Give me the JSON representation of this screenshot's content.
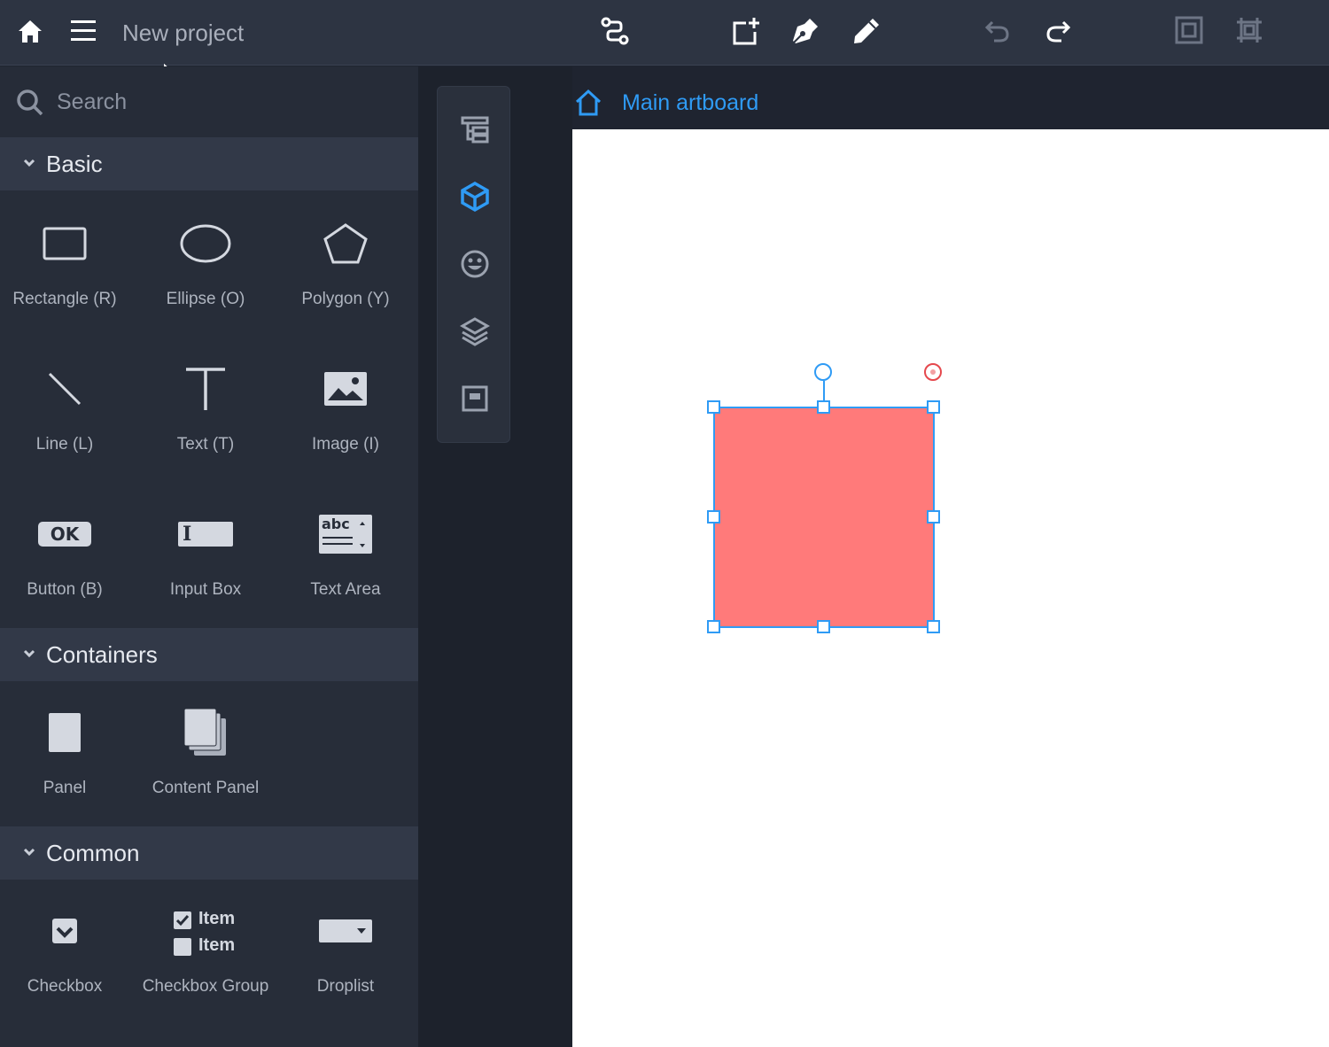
{
  "topbar": {
    "project_title": "New project",
    "icons": [
      "home-icon",
      "menu-icon",
      "connector-icon",
      "new-page-icon",
      "pen-icon",
      "pencil-icon",
      "undo-icon",
      "redo-icon",
      "frame-icon",
      "group-frame-icon"
    ]
  },
  "leftpanel": {
    "search": {
      "placeholder": "Search",
      "value": ""
    },
    "sections": {
      "basic": {
        "title": "Basic",
        "items": [
          {
            "label": "Rectangle (R)",
            "icon": "rectangle-icon"
          },
          {
            "label": "Ellipse (O)",
            "icon": "ellipse-icon"
          },
          {
            "label": "Polygon (Y)",
            "icon": "polygon-icon"
          },
          {
            "label": "Line (L)",
            "icon": "line-icon"
          },
          {
            "label": "Text (T)",
            "icon": "text-icon"
          },
          {
            "label": "Image (I)",
            "icon": "image-icon"
          },
          {
            "label": "Button (B)",
            "icon": "button-icon",
            "glyph": "OK"
          },
          {
            "label": "Input Box",
            "icon": "input-box-icon",
            "glyph": "I"
          },
          {
            "label": "Text Area",
            "icon": "text-area-icon",
            "glyph": "abc"
          }
        ]
      },
      "containers": {
        "title": "Containers",
        "items": [
          {
            "label": "Panel",
            "icon": "panel-icon"
          },
          {
            "label": "Content Panel",
            "icon": "content-panel-icon"
          }
        ]
      },
      "common": {
        "title": "Common",
        "items": [
          {
            "label": "Checkbox",
            "icon": "checkbox-icon"
          },
          {
            "label": "Checkbox Group",
            "icon": "checkbox-group-icon",
            "item1": "Item",
            "item2": "Item"
          },
          {
            "label": "Droplist",
            "icon": "droplist-icon"
          }
        ]
      }
    }
  },
  "toolstrip": {
    "icons": [
      "outline-tree-icon",
      "components-cube-icon",
      "emoji-icon",
      "layers-icon",
      "master-icon"
    ],
    "active": "components-cube-icon"
  },
  "canvas": {
    "breadcrumb": "Main artboard",
    "shape": {
      "type": "rectangle",
      "fill": "#ff7a7a",
      "stroke": "#2f9bf5",
      "selected": true
    }
  },
  "colors": {
    "accent": "#2f9bf5",
    "shape_fill": "#ff7a7a",
    "panel": "#272d39",
    "toolbar": "#2d3442"
  }
}
